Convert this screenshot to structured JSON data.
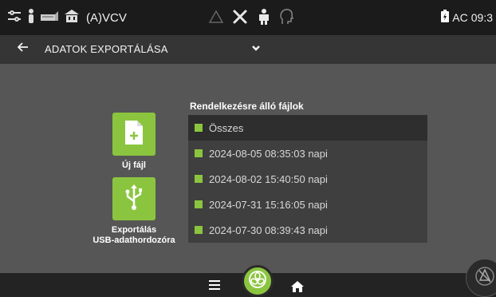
{
  "status_bar": {
    "mode": "(A)VCV",
    "ac_label": "AC",
    "clock": "09:3"
  },
  "header": {
    "title": "ADATOK EXPORTÁLÁSA"
  },
  "actions": {
    "new_file": {
      "label": "Új fájl"
    },
    "export_usb": {
      "line1": "Exportálás",
      "line2": "USB-adathordozóra"
    }
  },
  "files": {
    "title": "Rendelkezésre álló fájlok",
    "all_label": "Összes",
    "items": [
      {
        "label": "2024-08-05 08:35:03 napi"
      },
      {
        "label": "2024-08-02 15:40:50 napi"
      },
      {
        "label": "2024-07-31 15:16:05 napi"
      },
      {
        "label": "2024-07-30 08:39:43 napi"
      }
    ]
  },
  "colors": {
    "accent": "#8bc53f",
    "status_bar_bg": "#1b1b1b",
    "title_bar_bg": "#353535",
    "main_bg": "#565656",
    "panel_bg": "#3f3f3f"
  }
}
